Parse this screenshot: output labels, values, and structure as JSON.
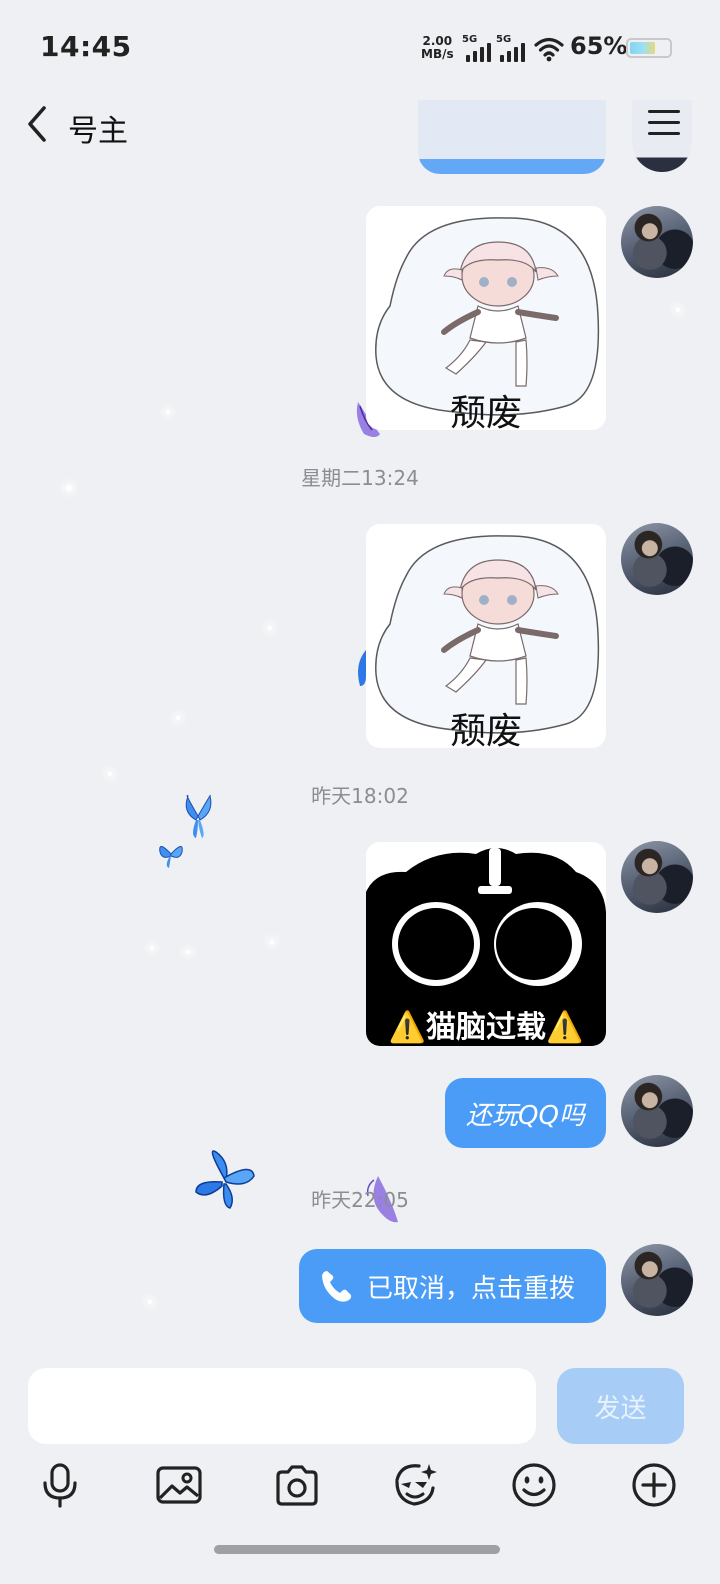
{
  "status_bar": {
    "time": "14:45",
    "net_speed_value": "2.00",
    "net_speed_unit": "MB/s",
    "signal_1_label": "5G",
    "signal_2_label": "5G",
    "battery_percent": "65%",
    "battery_level": 0.65
  },
  "header": {
    "title": "号主",
    "back_icon": "chevron-left-icon",
    "menu_icon": "hamburger-menu-icon"
  },
  "messages": [
    {
      "type": "sticker",
      "caption": "颓废"
    },
    {
      "type": "timestamp",
      "text": "星期二13:24"
    },
    {
      "type": "sticker",
      "caption": "颓废"
    },
    {
      "type": "timestamp",
      "text": "昨天18:02"
    },
    {
      "type": "sticker",
      "caption": "⚠️猫脑过载⚠️"
    },
    {
      "type": "text",
      "text": "还玩QQ吗"
    },
    {
      "type": "timestamp",
      "text": "昨天22:05"
    },
    {
      "type": "call",
      "text": "已取消，点击重拨",
      "icon": "phone-icon"
    }
  ],
  "input": {
    "placeholder": "",
    "value": "",
    "send_label": "发送"
  },
  "toolbar": [
    {
      "icon": "microphone-icon"
    },
    {
      "icon": "image-icon"
    },
    {
      "icon": "camera-icon"
    },
    {
      "icon": "sticker-face-icon"
    },
    {
      "icon": "emoji-icon"
    },
    {
      "icon": "plus-circle-icon"
    }
  ],
  "colors": {
    "accent": "#4a9cf6",
    "send_disabled": "#a7cdf7",
    "background": "#eff0f3",
    "timestamp": "#8a8d93"
  }
}
